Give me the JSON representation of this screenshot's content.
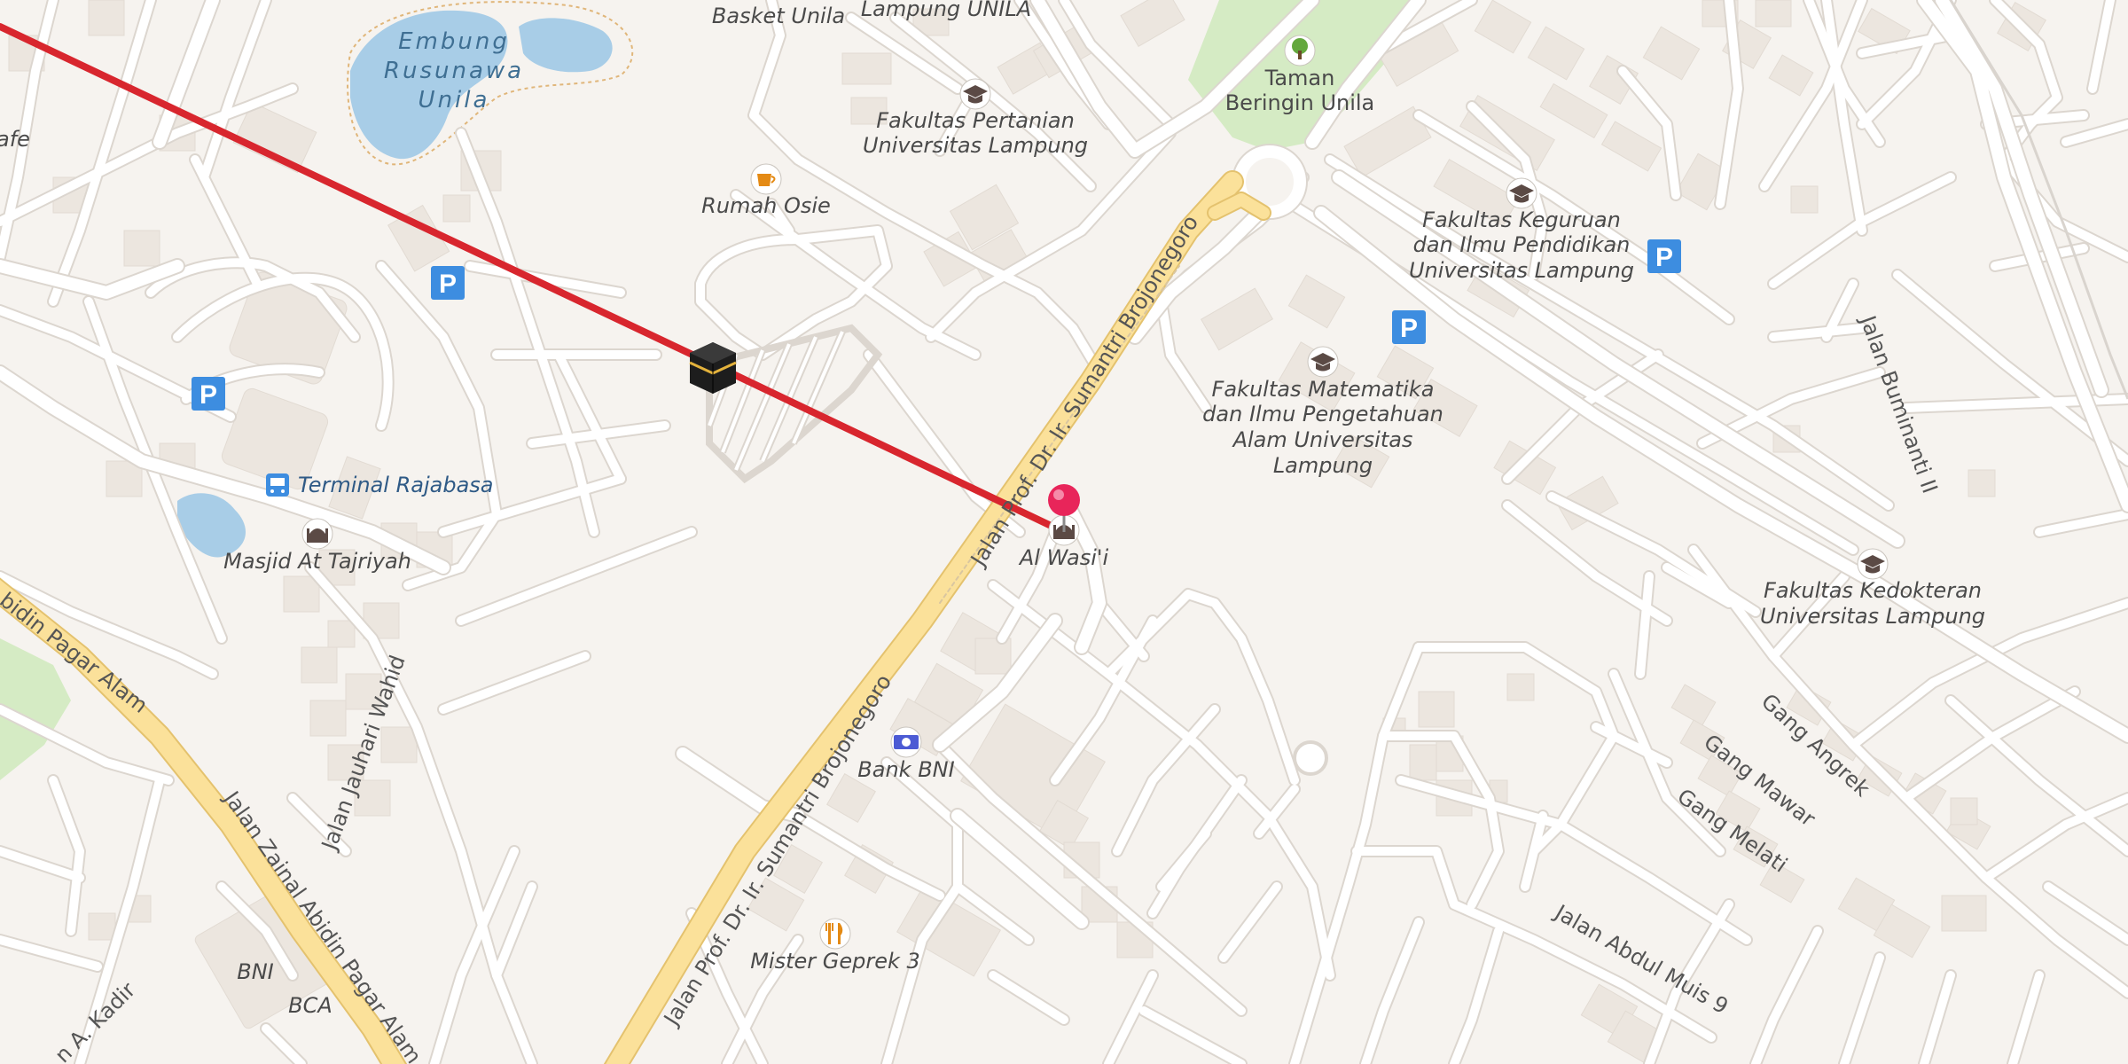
{
  "map": {
    "colors": {
      "land": "#f6f3ef",
      "building": "#ece6df",
      "minor_road": "#ffffff",
      "road_casing": "#dcd6cf",
      "major_road": "#fbe19a",
      "major_road_casing": "#e4c26e",
      "water": "#a8cde7",
      "park": "#d5ebc4",
      "route_line": "#d8262e",
      "parking": "#3d8de0",
      "pin": "#e8255a"
    },
    "water_label": [
      "Embung",
      "Rusunawa",
      "Unila"
    ],
    "park_label": [
      "Taman",
      "Beringin Unila"
    ],
    "pois": {
      "basket_unila": "Basket Unila",
      "lampung_unila": "Lampung UNILA",
      "fak_pertanian": [
        "Fakultas Pertanian",
        "Universitas Lampung"
      ],
      "rumah_osie": "Rumah Osie",
      "fak_keguruan": [
        "Fakultas Keguruan",
        "dan Ilmu Pendidikan",
        "Universitas Lampung"
      ],
      "fak_mipa": [
        "Fakultas Matematika",
        "dan Ilmu Pengetahuan",
        "Alam Universitas",
        "Lampung"
      ],
      "fak_kedokteran": [
        "Fakultas Kedokteran",
        "Universitas Lampung"
      ],
      "terminal": "Terminal Rajabasa",
      "masjid": "Masjid At Tajriyah",
      "al_wasii": "Al Wasi'i",
      "bank_bni": "Bank BNI",
      "mister_geprek": "Mister Geprek 3",
      "bni": "BNI",
      "bca": "BCA",
      "cafe_partial": "afe"
    },
    "roads": {
      "brojonegoro": "Jalan Prof. Dr. Ir. Sumantri Brojonegoro",
      "zainal": "Jalan Zainal Abidin Pagar Alam",
      "zainal_partial": "bidin Pagar Alam",
      "jauhari": "Jalan Jauhari Wahid",
      "buminanti": "Jalan Buminanti II",
      "gang_angrek": "Gang Angrek",
      "gang_mawar": "Gang Mawar",
      "gang_melati": "Gang Melati",
      "abdul_muis": "Jalan Abdul Muis 9",
      "a_kadir": "n A. Kadir"
    },
    "icons": {
      "parking_letter": "P",
      "kaaba": "kaaba-icon",
      "pin": "location-pin-icon",
      "university": "graduation-cap-icon",
      "cafe": "coffee-cup-icon",
      "restaurant": "fork-knife-icon",
      "bank": "banknote-icon",
      "mosque": "mosque-icon",
      "bus": "bus-icon",
      "tree": "tree-icon"
    }
  }
}
